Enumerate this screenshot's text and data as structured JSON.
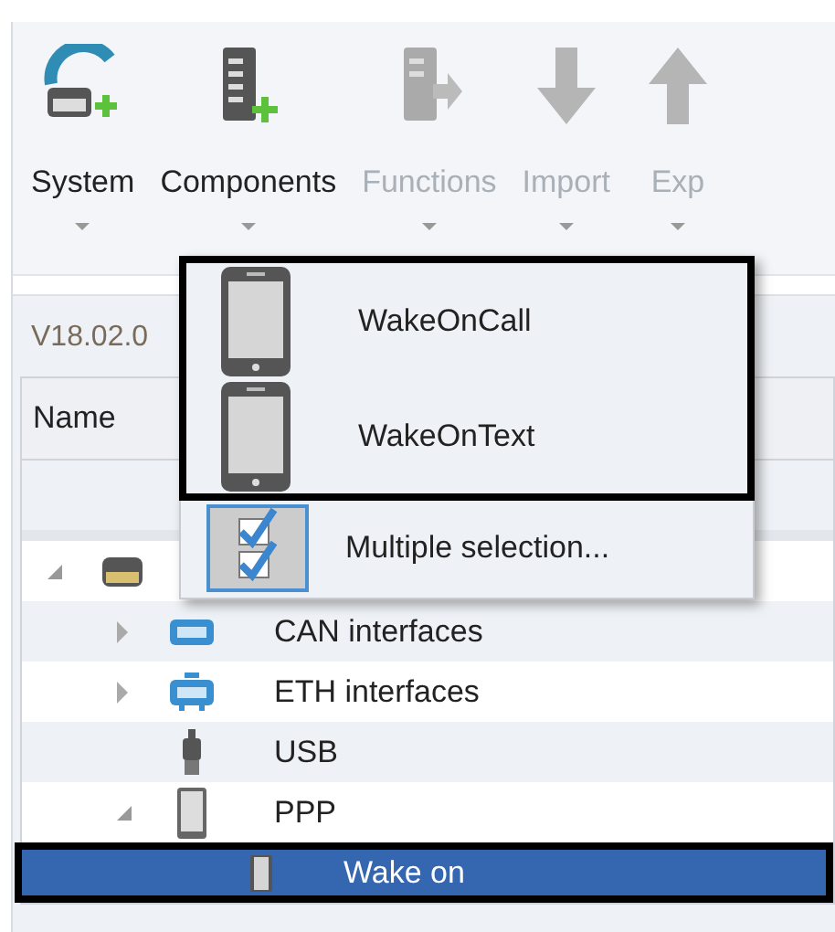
{
  "toolbar": {
    "buttons": [
      {
        "label": "System",
        "kind": "system",
        "disabled": false
      },
      {
        "label": "Components",
        "kind": "components",
        "disabled": false
      },
      {
        "label": "Functions",
        "kind": "functions",
        "disabled": true
      },
      {
        "label": "Import",
        "kind": "import",
        "disabled": true
      },
      {
        "label": "Exp",
        "kind": "export",
        "disabled": true
      }
    ]
  },
  "panel": {
    "version": "V18.02.0",
    "columns": [
      "Name"
    ],
    "tree": [
      {
        "kind": "system",
        "expanded": true,
        "selected": false,
        "children": [
          {
            "label": "CAN interfaces",
            "kind": "can",
            "expanded": false,
            "selected": false
          },
          {
            "label": "ETH interfaces",
            "kind": "eth",
            "expanded": false,
            "selected": false
          },
          {
            "label": "USB",
            "kind": "usb",
            "selected": false
          },
          {
            "label": "PPP",
            "kind": "phone",
            "expanded": true,
            "selected": false,
            "children": [
              {
                "label": "Wake on",
                "kind": "phone-small",
                "selected": true
              }
            ]
          }
        ]
      }
    ]
  },
  "dropdown_menu": {
    "items": [
      {
        "label": "WakeOnCall",
        "kind": "device",
        "highlighted": true
      },
      {
        "label": "WakeOnText",
        "kind": "device",
        "highlighted": true
      },
      {
        "label": "Multiple selection...",
        "kind": "multi",
        "highlighted": false
      }
    ]
  }
}
